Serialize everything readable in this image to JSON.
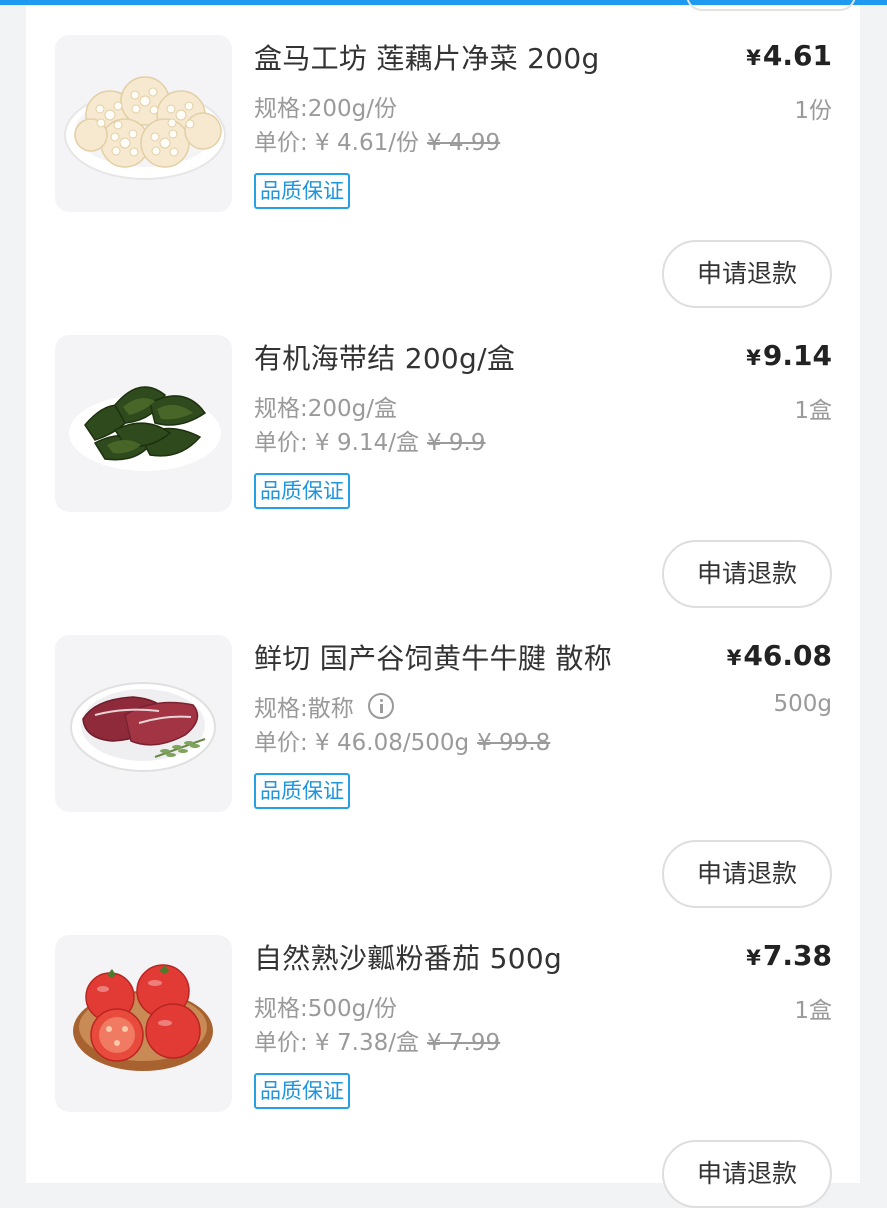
{
  "colors": {
    "accent": "#1e9bf0",
    "badge": "#27a0e3",
    "text": "#333333",
    "muted": "#9a9a9a"
  },
  "items": [
    {
      "name": "盒马工坊 莲藕片净菜 200g",
      "currency": "¥",
      "price": "4.61",
      "spec": "规格:200g/份",
      "quantity": "1份",
      "unit_price": "单价: ¥ 4.61/份",
      "original_price": "¥ 4.99",
      "badge": "品质保证",
      "refund_label": "申请退款",
      "image_icon": "lotus-root-slices-image"
    },
    {
      "name": "有机海带结 200g/盒",
      "currency": "¥",
      "price": "9.14",
      "spec": "规格:200g/盒",
      "quantity": "1盒",
      "unit_price": "单价: ¥ 9.14/盒",
      "original_price": "¥ 9.9",
      "badge": "品质保证",
      "refund_label": "申请退款",
      "image_icon": "kelp-knots-image"
    },
    {
      "name": "鲜切 国产谷饲黄牛牛腱 散称",
      "currency": "¥",
      "price": "46.08",
      "spec": "规格:散称",
      "quantity": "500g",
      "unit_price": "单价: ¥ 46.08/500g",
      "original_price": "¥ 99.8",
      "badge": "品质保证",
      "refund_label": "申请退款",
      "image_icon": "beef-shank-image",
      "spec_info_icon": "info-icon"
    },
    {
      "name": "自然熟沙瓤粉番茄 500g",
      "currency": "¥",
      "price": "7.38",
      "spec": "规格:500g/份",
      "quantity": "1盒",
      "unit_price": "单价: ¥ 7.38/盒",
      "original_price": "¥ 7.99",
      "badge": "品质保证",
      "refund_label": "申请退款",
      "image_icon": "tomatoes-image"
    }
  ]
}
